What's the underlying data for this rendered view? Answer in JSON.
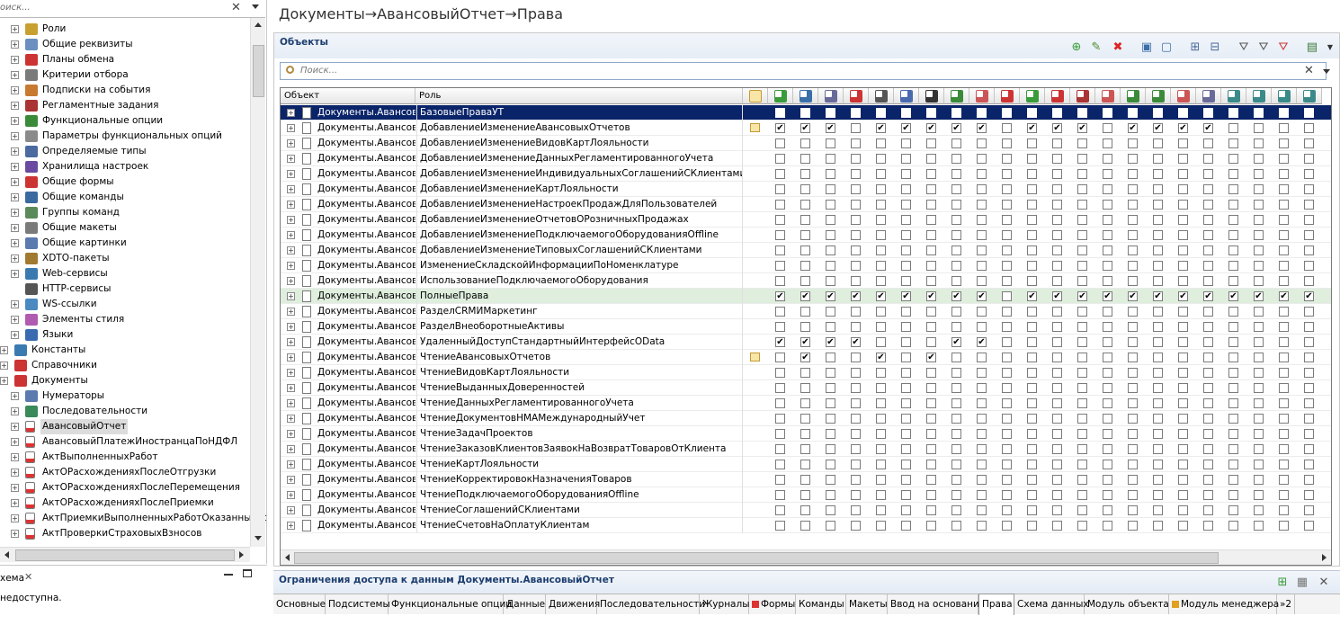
{
  "left_panel": {
    "search_placeholder": "оиск...",
    "tree": [
      {
        "label": "Роли",
        "indent": 2,
        "icon": "role-icon",
        "expand": true
      },
      {
        "label": "Общие реквизиты",
        "indent": 2,
        "icon": "common-attributes-icon",
        "expand": true
      },
      {
        "label": "Планы обмена",
        "indent": 2,
        "icon": "exchange-plans-icon",
        "expand": true
      },
      {
        "label": "Критерии отбора",
        "indent": 2,
        "icon": "filter-criteria-icon",
        "expand": true
      },
      {
        "label": "Подписки на события",
        "indent": 2,
        "icon": "event-subscriptions-icon",
        "expand": true
      },
      {
        "label": "Регламентные задания",
        "indent": 2,
        "icon": "scheduled-jobs-icon",
        "expand": true
      },
      {
        "label": "Функциональные опции",
        "indent": 2,
        "icon": "functional-options-icon",
        "expand": true
      },
      {
        "label": "Параметры функциональных опций",
        "indent": 2,
        "icon": "functional-option-params-icon",
        "expand": true
      },
      {
        "label": "Определяемые типы",
        "indent": 2,
        "icon": "defined-types-icon",
        "expand": true
      },
      {
        "label": "Хранилища настроек",
        "indent": 2,
        "icon": "settings-storage-icon",
        "expand": true
      },
      {
        "label": "Общие формы",
        "indent": 2,
        "icon": "common-forms-icon",
        "expand": true
      },
      {
        "label": "Общие команды",
        "indent": 2,
        "icon": "common-commands-icon",
        "expand": true
      },
      {
        "label": "Группы команд",
        "indent": 2,
        "icon": "command-groups-icon",
        "expand": true
      },
      {
        "label": "Общие макеты",
        "indent": 2,
        "icon": "common-templates-icon",
        "expand": true
      },
      {
        "label": "Общие картинки",
        "indent": 2,
        "icon": "common-pictures-icon",
        "expand": true
      },
      {
        "label": "XDTO-пакеты",
        "indent": 2,
        "icon": "xdto-packages-icon",
        "expand": true
      },
      {
        "label": "Web-сервисы",
        "indent": 2,
        "icon": "web-services-icon",
        "expand": true
      },
      {
        "label": "HTTP-сервисы",
        "indent": 2,
        "icon": "http-services-icon",
        "expand": false
      },
      {
        "label": "WS-ссылки",
        "indent": 2,
        "icon": "ws-links-icon",
        "expand": true
      },
      {
        "label": "Элементы стиля",
        "indent": 2,
        "icon": "style-elements-icon",
        "expand": true
      },
      {
        "label": "Языки",
        "indent": 2,
        "icon": "languages-icon",
        "expand": true
      },
      {
        "label": "Константы",
        "indent": 1,
        "icon": "constants-icon",
        "expand": true
      },
      {
        "label": "Справочники",
        "indent": 1,
        "icon": "catalogs-icon",
        "expand": true
      },
      {
        "label": "Документы",
        "indent": 1,
        "icon": "documents-icon",
        "expand": true
      },
      {
        "label": "Нумераторы",
        "indent": 2,
        "icon": "numerators-icon",
        "expand": true
      },
      {
        "label": "Последовательности",
        "indent": 2,
        "icon": "sequences-icon",
        "expand": true
      },
      {
        "label": "АвансовыйОтчет",
        "indent": 2,
        "icon": "document-icon",
        "expand": true,
        "selected": true
      },
      {
        "label": "АвансовыйПлатежИностранцаПоНДФЛ",
        "indent": 2,
        "icon": "document-icon",
        "expand": true
      },
      {
        "label": "АктВыполненныхРабот",
        "indent": 2,
        "icon": "document-icon",
        "expand": true
      },
      {
        "label": "АктОРасхожденияхПослеОтгрузки",
        "indent": 2,
        "icon": "document-icon",
        "expand": true
      },
      {
        "label": "АктОРасхожденияхПослеПеремещения",
        "indent": 2,
        "icon": "document-icon",
        "expand": true
      },
      {
        "label": "АктОРасхожденияхПослеПриемки",
        "indent": 2,
        "icon": "document-icon",
        "expand": true
      },
      {
        "label": "АктПриемкиВыполненныхРаботОказанныхУс",
        "indent": 2,
        "icon": "document-icon",
        "expand": true
      },
      {
        "label": "АктПроверкиСтраховыхВзносов",
        "indent": 2,
        "icon": "document-icon",
        "expand": true
      }
    ],
    "bottom_tab_label": "хема",
    "bottom_message": "недоступна."
  },
  "main": {
    "title": "Документы→АвансовыйОтчет→Права",
    "objects_title": "Объекты",
    "search_placeholder": "Поиск...",
    "columns": {
      "object": "Объект",
      "role": "Роль"
    },
    "object_text": "Документы.Авансов",
    "right_icons": [
      "insert-icon",
      "read-icon",
      "update-icon",
      "delete-icon",
      "view-icon",
      "edit-icon",
      "input-by-string-icon",
      "posting-icon",
      "undo-posting-icon",
      "interactive-delete-icon",
      "interactive-insert-icon",
      "interactive-set-deletion-mark-icon",
      "interactive-clear-deletion-mark-icon",
      "interactive-delete-marked-icon",
      "interactive-posting-icon",
      "interactive-posting-regular-icon",
      "interactive-undo-posting-icon",
      "interactive-change-posted-icon",
      "read-data-history-icon",
      "view-data-history-icon",
      "edit-data-history-icon",
      "update-data-history-icon"
    ],
    "rows": [
      {
        "role": "БазовыеПраваУТ",
        "selected": true,
        "restr": false,
        "checks": [
          0,
          0,
          0,
          0,
          0,
          0,
          0,
          0,
          0,
          0,
          0,
          0,
          0,
          0,
          0,
          0,
          0,
          0,
          0,
          0,
          0,
          0
        ]
      },
      {
        "role": "ДобавлениеИзменениеАвансовыхОтчетов",
        "restr": true,
        "checks": [
          1,
          1,
          1,
          0,
          1,
          1,
          1,
          1,
          1,
          0,
          1,
          1,
          1,
          0,
          1,
          1,
          1,
          1,
          0,
          0,
          0,
          0
        ]
      },
      {
        "role": "ДобавлениеИзменениеВидовКартЛояльности",
        "restr": false,
        "checks": [
          0,
          0,
          0,
          0,
          0,
          0,
          0,
          0,
          0,
          0,
          0,
          0,
          0,
          0,
          0,
          0,
          0,
          0,
          0,
          0,
          0,
          0
        ]
      },
      {
        "role": "ДобавлениеИзменениеДанныхРегламентированногоУчета",
        "restr": false,
        "checks": [
          0,
          0,
          0,
          0,
          0,
          0,
          0,
          0,
          0,
          0,
          0,
          0,
          0,
          0,
          0,
          0,
          0,
          0,
          0,
          0,
          0,
          0
        ]
      },
      {
        "role": "ДобавлениеИзменениеИндивидуальныхСоглашенийСКлиентами",
        "restr": false,
        "checks": [
          0,
          0,
          0,
          0,
          0,
          0,
          0,
          0,
          0,
          0,
          0,
          0,
          0,
          0,
          0,
          0,
          0,
          0,
          0,
          0,
          0,
          0
        ]
      },
      {
        "role": "ДобавлениеИзменениеКартЛояльности",
        "restr": false,
        "checks": [
          0,
          0,
          0,
          0,
          0,
          0,
          0,
          0,
          0,
          0,
          0,
          0,
          0,
          0,
          0,
          0,
          0,
          0,
          0,
          0,
          0,
          0
        ]
      },
      {
        "role": "ДобавлениеИзменениеНастроекПродажДляПользователей",
        "restr": false,
        "checks": [
          0,
          0,
          0,
          0,
          0,
          0,
          0,
          0,
          0,
          0,
          0,
          0,
          0,
          0,
          0,
          0,
          0,
          0,
          0,
          0,
          0,
          0
        ]
      },
      {
        "role": "ДобавлениеИзменениеОтчетовОРозничныхПродажах",
        "restr": false,
        "checks": [
          0,
          0,
          0,
          0,
          0,
          0,
          0,
          0,
          0,
          0,
          0,
          0,
          0,
          0,
          0,
          0,
          0,
          0,
          0,
          0,
          0,
          0
        ]
      },
      {
        "role": "ДобавлениеИзменениеПодключаемогоОборудованияOffline",
        "restr": false,
        "checks": [
          0,
          0,
          0,
          0,
          0,
          0,
          0,
          0,
          0,
          0,
          0,
          0,
          0,
          0,
          0,
          0,
          0,
          0,
          0,
          0,
          0,
          0
        ]
      },
      {
        "role": "ДобавлениеИзменениеТиповыхСоглашенийСКлиентами",
        "restr": false,
        "checks": [
          0,
          0,
          0,
          0,
          0,
          0,
          0,
          0,
          0,
          0,
          0,
          0,
          0,
          0,
          0,
          0,
          0,
          0,
          0,
          0,
          0,
          0
        ]
      },
      {
        "role": "ИзменениеСкладскойИнформацииПоНоменклатуре",
        "restr": false,
        "checks": [
          0,
          0,
          0,
          0,
          0,
          0,
          0,
          0,
          0,
          0,
          0,
          0,
          0,
          0,
          0,
          0,
          0,
          0,
          0,
          0,
          0,
          0
        ]
      },
      {
        "role": "ИспользованиеПодключаемогоОборудования",
        "restr": false,
        "checks": [
          0,
          0,
          0,
          0,
          0,
          0,
          0,
          0,
          0,
          0,
          0,
          0,
          0,
          0,
          0,
          0,
          0,
          0,
          0,
          0,
          0,
          0
        ]
      },
      {
        "role": "ПолныеПрава",
        "highlight": true,
        "restr": false,
        "checks": [
          1,
          1,
          1,
          1,
          1,
          1,
          1,
          1,
          1,
          0,
          1,
          1,
          1,
          1,
          1,
          1,
          1,
          1,
          1,
          1,
          1,
          1
        ]
      },
      {
        "role": "РазделCRMИМаркетинг",
        "restr": false,
        "checks": [
          0,
          0,
          0,
          0,
          0,
          0,
          0,
          0,
          0,
          0,
          0,
          0,
          0,
          0,
          0,
          0,
          0,
          0,
          0,
          0,
          0,
          0
        ]
      },
      {
        "role": "РазделВнеоборотныеАктивы",
        "restr": false,
        "checks": [
          0,
          0,
          0,
          0,
          0,
          0,
          0,
          0,
          0,
          0,
          0,
          0,
          0,
          0,
          0,
          0,
          0,
          0,
          0,
          0,
          0,
          0
        ]
      },
      {
        "role": "УдаленныйДоступСтандартныйИнтерфейсOData",
        "restr": false,
        "checks": [
          1,
          1,
          1,
          1,
          0,
          0,
          0,
          1,
          1,
          0,
          0,
          0,
          0,
          0,
          0,
          0,
          0,
          0,
          0,
          0,
          0,
          0
        ]
      },
      {
        "role": "ЧтениеАвансовыхОтчетов",
        "restr": true,
        "checks": [
          0,
          1,
          0,
          0,
          1,
          0,
          1,
          0,
          0,
          0,
          0,
          0,
          0,
          0,
          0,
          0,
          0,
          0,
          0,
          0,
          0,
          0
        ]
      },
      {
        "role": "ЧтениеВидовКартЛояльности",
        "restr": false,
        "checks": [
          0,
          0,
          0,
          0,
          0,
          0,
          0,
          0,
          0,
          0,
          0,
          0,
          0,
          0,
          0,
          0,
          0,
          0,
          0,
          0,
          0,
          0
        ]
      },
      {
        "role": "ЧтениеВыданныхДоверенностей",
        "restr": false,
        "checks": [
          0,
          0,
          0,
          0,
          0,
          0,
          0,
          0,
          0,
          0,
          0,
          0,
          0,
          0,
          0,
          0,
          0,
          0,
          0,
          0,
          0,
          0
        ]
      },
      {
        "role": "ЧтениеДанныхРегламентированногоУчета",
        "restr": false,
        "checks": [
          0,
          0,
          0,
          0,
          0,
          0,
          0,
          0,
          0,
          0,
          0,
          0,
          0,
          0,
          0,
          0,
          0,
          0,
          0,
          0,
          0,
          0
        ]
      },
      {
        "role": "ЧтениеДокументовНМАМеждународныйУчет",
        "restr": false,
        "checks": [
          0,
          0,
          0,
          0,
          0,
          0,
          0,
          0,
          0,
          0,
          0,
          0,
          0,
          0,
          0,
          0,
          0,
          0,
          0,
          0,
          0,
          0
        ]
      },
      {
        "role": "ЧтениеЗадачПроектов",
        "restr": false,
        "checks": [
          0,
          0,
          0,
          0,
          0,
          0,
          0,
          0,
          0,
          0,
          0,
          0,
          0,
          0,
          0,
          0,
          0,
          0,
          0,
          0,
          0,
          0
        ]
      },
      {
        "role": "ЧтениеЗаказовКлиентовЗаявокНаВозвратТоваровОтКлиента",
        "restr": false,
        "checks": [
          0,
          0,
          0,
          0,
          0,
          0,
          0,
          0,
          0,
          0,
          0,
          0,
          0,
          0,
          0,
          0,
          0,
          0,
          0,
          0,
          0,
          0
        ]
      },
      {
        "role": "ЧтениеКартЛояльности",
        "restr": false,
        "checks": [
          0,
          0,
          0,
          0,
          0,
          0,
          0,
          0,
          0,
          0,
          0,
          0,
          0,
          0,
          0,
          0,
          0,
          0,
          0,
          0,
          0,
          0
        ]
      },
      {
        "role": "ЧтениеКорректировокНазначенияТоваров",
        "restr": false,
        "checks": [
          0,
          0,
          0,
          0,
          0,
          0,
          0,
          0,
          0,
          0,
          0,
          0,
          0,
          0,
          0,
          0,
          0,
          0,
          0,
          0,
          0,
          0
        ]
      },
      {
        "role": "ЧтениеПодключаемогоОборудованияOffline",
        "restr": false,
        "checks": [
          0,
          0,
          0,
          0,
          0,
          0,
          0,
          0,
          0,
          0,
          0,
          0,
          0,
          0,
          0,
          0,
          0,
          0,
          0,
          0,
          0,
          0
        ]
      },
      {
        "role": "ЧтениеСоглашенийСКлиентами",
        "restr": false,
        "checks": [
          0,
          0,
          0,
          0,
          0,
          0,
          0,
          0,
          0,
          0,
          0,
          0,
          0,
          0,
          0,
          0,
          0,
          0,
          0,
          0,
          0,
          0
        ]
      },
      {
        "role": "ЧтениеСчетовНаОплатуКлиентам",
        "restr": false,
        "checks": [
          0,
          0,
          0,
          0,
          0,
          0,
          0,
          0,
          0,
          0,
          0,
          0,
          0,
          0,
          0,
          0,
          0,
          0,
          0,
          0,
          0,
          0
        ]
      }
    ],
    "restrictions_title": "Ограничения доступа к данным Документы.АвансовыйОтчет",
    "tabs": [
      {
        "label": "Основные"
      },
      {
        "label": "Подсистемы"
      },
      {
        "label": "Функциональные опции"
      },
      {
        "label": "Данные"
      },
      {
        "label": "Движения"
      },
      {
        "label": "Последовательности"
      },
      {
        "label": "Журналы"
      },
      {
        "label": "Формы",
        "warn": true
      },
      {
        "label": "Команды"
      },
      {
        "label": "Макеты"
      },
      {
        "label": "Ввод на основании"
      },
      {
        "label": "Права",
        "active": true
      },
      {
        "label": "Схема данных"
      },
      {
        "label": "Модуль объекта"
      },
      {
        "label": "Модуль менеджера",
        "warn": true
      },
      {
        "label": "»2"
      }
    ]
  },
  "colors": {
    "selection": "#0a246a",
    "row_highlight": "#dfeedd",
    "panel_title": "#1c3d6e"
  }
}
